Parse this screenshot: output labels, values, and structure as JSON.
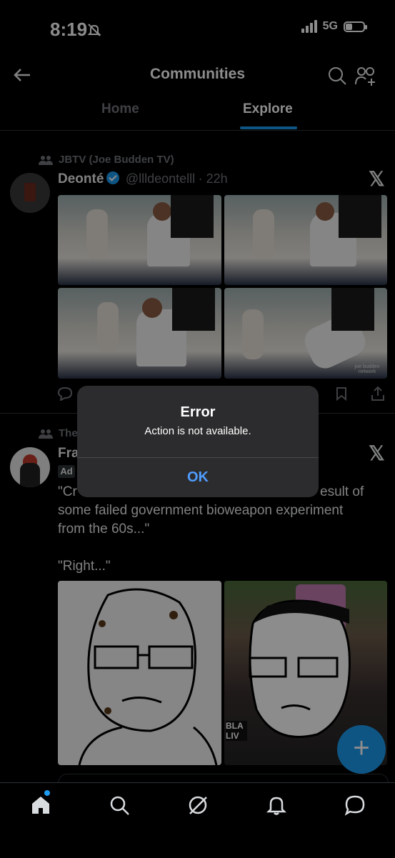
{
  "status_bar": {
    "time": "8:19",
    "network": "5G"
  },
  "header": {
    "title": "Communities"
  },
  "tabs": [
    {
      "label": "Home"
    },
    {
      "label": "Explore"
    }
  ],
  "post1": {
    "community": "JBTV (Joe Budden TV)",
    "author": "Deonté",
    "handle": "@llldeontelll",
    "time": "· 22h",
    "watermark": "joe budden network"
  },
  "post2": {
    "community": "The",
    "author": "Fra",
    "ad_badge": "Ad",
    "text_line1": "\"Cr",
    "text_line1_end": "esult of",
    "text_line2": "some failed government bioweapon experiment",
    "text_line3": "from the 60s...\"",
    "text_line4": "\"Right...\"",
    "meme_sign_text": "BLA LIV"
  },
  "dialog": {
    "title": "Error",
    "message": "Action is not available.",
    "button": "OK"
  },
  "fab": {
    "label": "+"
  },
  "colors": {
    "accent": "#1d9bf0",
    "background": "#000000",
    "dialog_bg": "#2c2c2e",
    "ok_blue": "#4f9dff"
  }
}
